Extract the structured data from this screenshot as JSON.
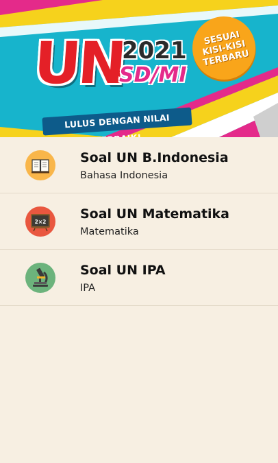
{
  "banner": {
    "exam": "UN",
    "year": "2021",
    "level": "SD/MI",
    "tagline": "LULUS DENGAN NILAI TERBAIK!",
    "badge_lines": [
      "SESUAI",
      "KISI-KISI",
      "TERBARU"
    ],
    "colors": {
      "background": "#17b4cc",
      "accent_red": "#e42027",
      "accent_pink": "#e42a8a",
      "accent_yellow": "#f6d21c",
      "badge": "#f9a51a"
    }
  },
  "subjects": [
    {
      "title": "Soal UN B.Indonesia",
      "subtitle": "Bahasa Indonesia",
      "icon": "book-icon",
      "icon_bg": "#f9b64a"
    },
    {
      "title": "Soal UN Matematika",
      "subtitle": "Matematika",
      "icon": "chalkboard-icon",
      "icon_bg": "#e9573f"
    },
    {
      "title": "Soal UN IPA",
      "subtitle": "IPA",
      "icon": "microscope-icon",
      "icon_bg": "#6cb37c"
    }
  ],
  "colors": {
    "page_background": "#f7efe2",
    "divider": "#e3d9c8"
  }
}
